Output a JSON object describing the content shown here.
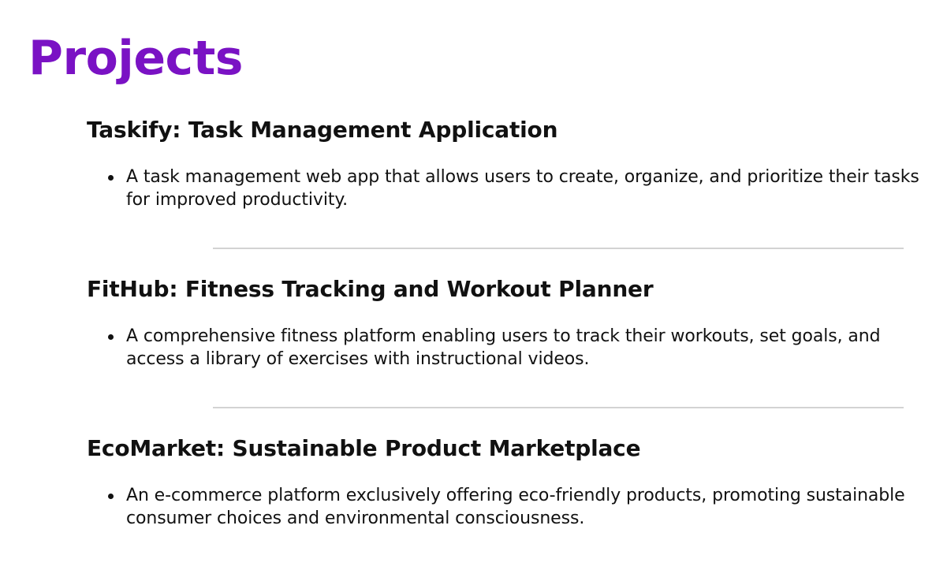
{
  "page": {
    "title": "Projects",
    "title_color": "#7a12c4"
  },
  "projects": [
    {
      "title": "Taskify: Task Management Application",
      "description": "A task management web app that allows users to create, organize, and prioritize their tasks for improved productivity."
    },
    {
      "title": "FitHub: Fitness Tracking and Workout Planner",
      "description": "A comprehensive fitness platform enabling users to track their workouts, set goals, and access a library of exercises with instructional videos."
    },
    {
      "title": "EcoMarket: Sustainable Product Marketplace",
      "description": "An e-commerce platform exclusively offering eco-friendly products, promoting sustainable consumer choices and environmental consciousness."
    }
  ]
}
